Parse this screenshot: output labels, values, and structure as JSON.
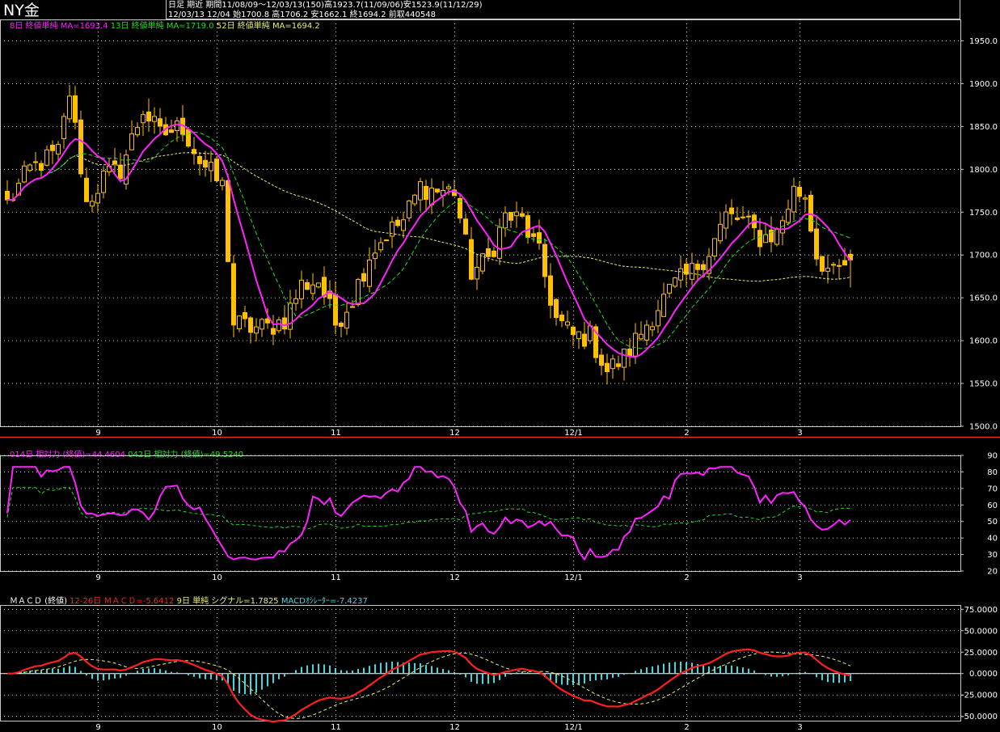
{
  "title": "NY金",
  "header": {
    "line1": "日足 期近 期間11/08/09～12/03/13(150)高1923.7(11/09/06)安1523.9(11/12/29)",
    "line2": "12/03/13 12/04 始1700.8 高1706.2 安1662.1 終1694.2 前取440548"
  },
  "colors": {
    "up": "#ffc000",
    "ma5": "#ff22ff",
    "ma13": "#22dd22",
    "ma52": "#e8f070",
    "rsi14": "#ff22ff",
    "rsi42": "#22dd22",
    "macd": "#ff2020",
    "signal": "#e8f070",
    "hist": "#40d8e0",
    "grid": "#ffffff"
  },
  "legends": {
    "price": [
      {
        "text": "8日 終値単純 MA=1693.4",
        "color": "#ff22ff"
      },
      {
        "text": "13日 終値単純 MA=1719.0",
        "color": "#22dd22"
      },
      {
        "text": "52日 終値単純 MA=1694.2",
        "color": "#e8f070"
      }
    ],
    "rsi": [
      {
        "text": "014日 相対力 (終値)=44.4604",
        "color": "#ff22ff"
      },
      {
        "text": "042日 相対力 (終値)=49.5240",
        "color": "#22dd22"
      }
    ],
    "macd": [
      {
        "text": "ＭＡＣＤ (終値)",
        "color": "#ffffff"
      },
      {
        "text": "12-26日 ＭＡＣＤ=-5.6412",
        "color": "#ff2020"
      },
      {
        "text": "9日 単純 シグナル=1.7825",
        "color": "#e8f070"
      },
      {
        "text": "MACDｵｼﾚｰﾀｰ=-7.4237",
        "color": "#40d8e0"
      }
    ]
  },
  "x_labels": [
    "9",
    "10",
    "11",
    "12",
    "12/1",
    "2",
    "3"
  ],
  "chart_data": [
    {
      "type": "candlestick",
      "title": "NY金",
      "x_labels": [
        "9",
        "10",
        "11",
        "12",
        "12/1",
        "2",
        "3"
      ],
      "ylim": [
        1500,
        1975
      ],
      "yticks": [
        "1950.0",
        "1900.0",
        "1850.0",
        "1800.0",
        "1750.0",
        "1700.0",
        "1650.0",
        "1600.0",
        "1550.0",
        "1500.0"
      ],
      "close_anchors": [
        [
          0,
          1760
        ],
        [
          4,
          1800
        ],
        [
          9,
          1820
        ],
        [
          11,
          1890
        ],
        [
          14,
          1760
        ],
        [
          17,
          1790
        ],
        [
          20,
          1800
        ],
        [
          24,
          1870
        ],
        [
          27,
          1840
        ],
        [
          31,
          1850
        ],
        [
          34,
          1810
        ],
        [
          38,
          1780
        ],
        [
          40,
          1620
        ],
        [
          43,
          1615
        ],
        [
          46,
          1615
        ],
        [
          49,
          1625
        ],
        [
          52,
          1665
        ],
        [
          55,
          1670
        ],
        [
          58,
          1620
        ],
        [
          61,
          1650
        ],
        [
          64,
          1700
        ],
        [
          67,
          1725
        ],
        [
          70,
          1740
        ],
        [
          73,
          1780
        ],
        [
          76,
          1775
        ],
        [
          79,
          1775
        ],
        [
          82,
          1680
        ],
        [
          85,
          1695
        ],
        [
          88,
          1745
        ],
        [
          91,
          1740
        ],
        [
          94,
          1700
        ],
        [
          97,
          1625
        ],
        [
          100,
          1605
        ],
        [
          103,
          1605
        ],
        [
          106,
          1565
        ],
        [
          109,
          1580
        ],
        [
          112,
          1610
        ],
        [
          115,
          1640
        ],
        [
          118,
          1665
        ],
        [
          121,
          1680
        ],
        [
          124,
          1705
        ],
        [
          127,
          1745
        ],
        [
          130,
          1740
        ],
        [
          133,
          1720
        ],
        [
          136,
          1725
        ],
        [
          139,
          1775
        ],
        [
          141,
          1770
        ],
        [
          143,
          1700
        ],
        [
          146,
          1675
        ],
        [
          149,
          1694
        ]
      ],
      "series": [
        {
          "name": "8日 終値単純 MA",
          "last": 1693.4
        },
        {
          "name": "13日 終値単純 MA",
          "last": 1719.0
        },
        {
          "name": "52日 終値単純 MA",
          "last": 1694.2
        }
      ],
      "last_bar": {
        "open": 1700.8,
        "high": 1706.2,
        "low": 1662.1,
        "close": 1694.2
      },
      "period_high": 1923.7,
      "period_low": 1523.9,
      "grid": true
    },
    {
      "type": "line",
      "title": "",
      "ylim": [
        20,
        90
      ],
      "yticks": [
        "90",
        "80",
        "70",
        "60",
        "50",
        "40",
        "30",
        "20"
      ],
      "series": [
        {
          "name": "014日 相対力 (終値)",
          "last": 44.4604
        },
        {
          "name": "042日 相対力 (終値)",
          "last": 49.524
        }
      ],
      "grid": true
    },
    {
      "type": "line",
      "title": "ＭＡＣＤ (終値)",
      "ylim": [
        -50,
        75
      ],
      "yticks": [
        "75.0000",
        "50.0000",
        "25.0000",
        "0.0000",
        "-25.0000",
        "-50.0000"
      ],
      "series": [
        {
          "name": "12-26日 ＭＡＣＤ",
          "last": -5.6412
        },
        {
          "name": "9日 単純 シグナル",
          "last": 1.7825
        },
        {
          "name": "MACDｵｼﾚｰﾀｰ",
          "last": -7.4237
        }
      ],
      "grid": true
    }
  ]
}
